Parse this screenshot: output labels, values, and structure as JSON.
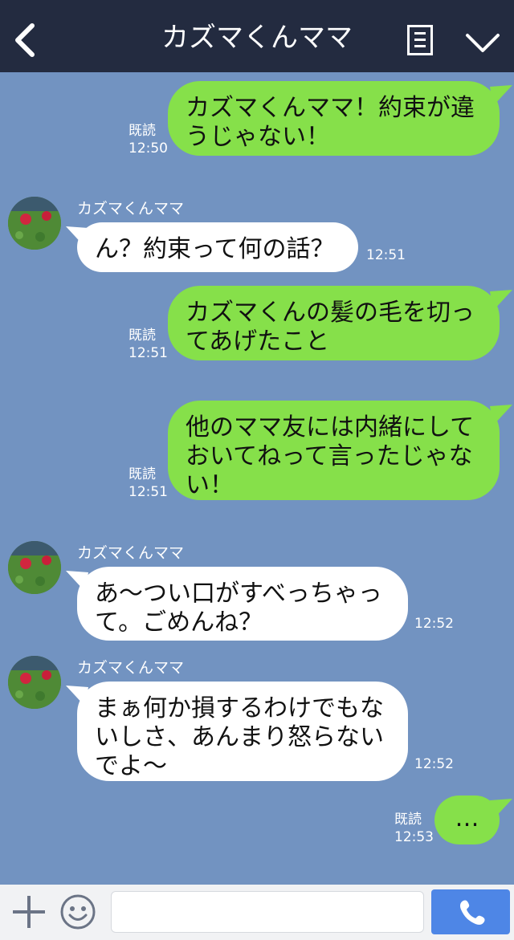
{
  "header": {
    "title": "カズマくんママ",
    "back_icon": "chevron-left-icon",
    "menu_icon": "note-list-icon",
    "more_icon": "chevron-down-icon"
  },
  "messages": [
    {
      "side": "right",
      "text": "カズマくんママ！約束が違うじゃない！",
      "read": "既読",
      "time": "12:50"
    },
    {
      "side": "left",
      "sender": "カズマくんママ",
      "text": "ん？約束って何の話？",
      "time": "12:51"
    },
    {
      "side": "right",
      "text": "カズマくんの髪の毛を切ってあげたこと",
      "read": "既読",
      "time": "12:51"
    },
    {
      "side": "right",
      "text": "他のママ友には内緒にしておいてねって言ったじゃない！",
      "read": "既読",
      "time": "12:51"
    },
    {
      "side": "left",
      "sender": "カズマくんママ",
      "text": "あ〜つい口がすべっちゃって。ごめんね？",
      "time": "12:52"
    },
    {
      "side": "left",
      "sender": "カズマくんママ",
      "text": "まぁ何か損するわけでもないしさ、あんまり怒らないでよ〜",
      "time": "12:52"
    },
    {
      "side": "right",
      "text": "…",
      "read": "既読",
      "time": "12:53"
    }
  ],
  "footer": {
    "plus_icon": "plus-icon",
    "emoji_icon": "smiley-icon",
    "input_value": "",
    "call_icon": "phone-icon"
  },
  "colors": {
    "header": "#232b40",
    "background": "#7293c1",
    "green_bubble": "#86e04a",
    "white_bubble": "#ffffff",
    "call_button": "#4e86e6"
  }
}
